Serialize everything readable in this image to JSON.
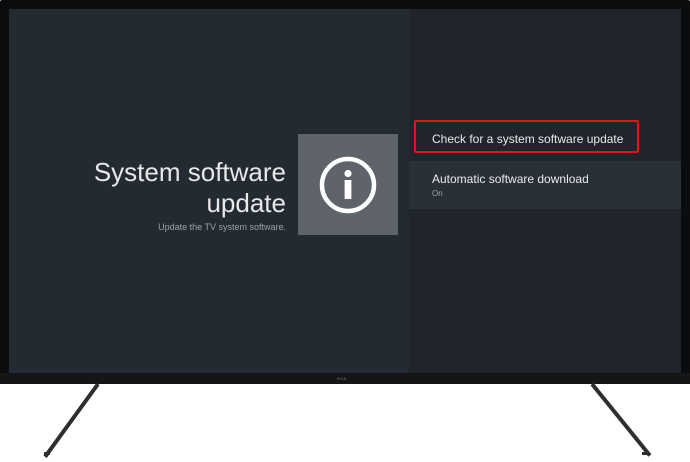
{
  "settings": {
    "title": "System software update",
    "subtitle": "Update the TV system software.",
    "icon": "info-icon"
  },
  "menu": {
    "items": [
      {
        "label": "Check for a system software update",
        "value": ""
      },
      {
        "label": "Automatic software download",
        "value": "On"
      }
    ]
  },
  "tv": {
    "brand_logo": "RCA"
  },
  "colors": {
    "screen_bg": "#242a31",
    "panel_bg": "#1f252b",
    "icon_tile": "#5e6469",
    "highlight": "#e3141c",
    "text_primary": "#e6e8ea",
    "text_secondary": "#9aa1a8"
  }
}
